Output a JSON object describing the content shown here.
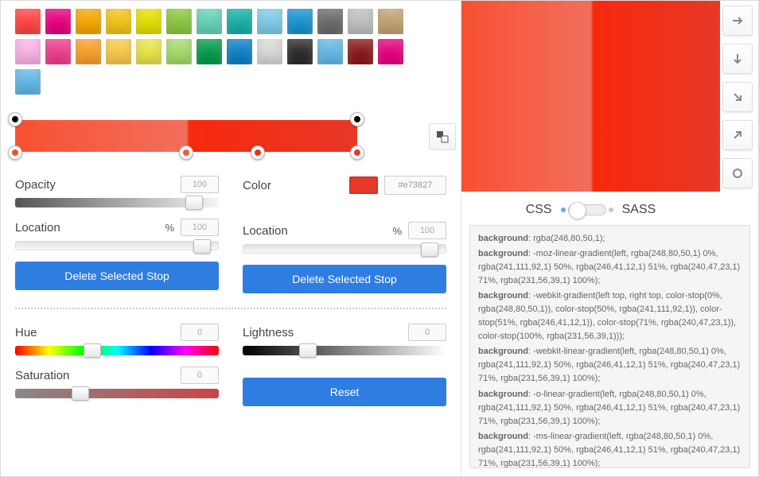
{
  "swatches": [
    [
      "#f44",
      "#e6007e",
      "#f7a600",
      "#f0c419",
      "#e3df00",
      "#8cc63f",
      "#66d1b5",
      "#16b1a5",
      "#7ecbe8",
      "#1893d1",
      "#6a6a6a",
      "#bfbfbf",
      "#c0a373"
    ],
    [
      "#fbb1e6",
      "#ef3d8e",
      "#f9a02a",
      "#f8c94a",
      "#e8e348",
      "#a6d96a",
      "#079b4a",
      "#0e80c7",
      "#d8d8d8",
      "#2b2b2b",
      "#63b8e5",
      "#8b1a1a",
      "#e6007e"
    ],
    [
      "#63b8e5"
    ]
  ],
  "grad_stops_top": [
    {
      "pos": 0,
      "dot": "#000"
    },
    {
      "pos": 100,
      "dot": "#000"
    }
  ],
  "grad_stops_bottom": [
    {
      "pos": 0,
      "dot": "#f84f32"
    },
    {
      "pos": 50,
      "dot": "#f05a3f"
    },
    {
      "pos": 71,
      "dot": "#f02f17"
    },
    {
      "pos": 100,
      "dot": "#e73827"
    }
  ],
  "opacity": {
    "label": "Opacity",
    "value": "100",
    "thumb_pct": 88
  },
  "locationL": {
    "label": "Location",
    "unit": "%",
    "value": "100",
    "thumb_pct": 92
  },
  "color": {
    "label": "Color",
    "hex": "#e73827"
  },
  "locationR": {
    "label": "Location",
    "unit": "%",
    "value": "100",
    "thumb_pct": 92
  },
  "deleteL": "Delete Selected Stop",
  "deleteR": "Delete Selected Stop",
  "hue": {
    "label": "Hue",
    "value": "0",
    "thumb_pct": 38
  },
  "sat": {
    "label": "Saturation",
    "value": "0",
    "thumb_pct": 32
  },
  "lightness": {
    "label": "Lightness",
    "value": "0",
    "thumb_pct": 32
  },
  "reset": "Reset",
  "tabs": {
    "css": "CSS",
    "sass": "SASS"
  },
  "css_lines": [
    {
      "prop": "background",
      "val": ": rgba(248,80,50,1);"
    },
    {
      "prop": "background",
      "val": ": -moz-linear-gradient(left, rgba(248,80,50,1) 0%, rgba(241,111,92,1) 50%, rgba(246,41,12,1) 51%, rgba(240,47,23,1) 71%, rgba(231,56,39,1) 100%);"
    },
    {
      "prop": "background",
      "val": ": -webkit-gradient(left top, right top, color-stop(0%, rgba(248,80,50,1)), color-stop(50%, rgba(241,111,92,1)), color-stop(51%, rgba(246,41,12,1)), color-stop(71%, rgba(240,47,23,1)), color-stop(100%, rgba(231,56,39,1)));"
    },
    {
      "prop": "background",
      "val": ": -webkit-linear-gradient(left, rgba(248,80,50,1) 0%, rgba(241,111,92,1) 50%, rgba(246,41,12,1) 51%, rgba(240,47,23,1) 71%, rgba(231,56,39,1) 100%);"
    },
    {
      "prop": "background",
      "val": ": -o-linear-gradient(left, rgba(248,80,50,1) 0%, rgba(241,111,92,1) 50%, rgba(246,41,12,1) 51%, rgba(240,47,23,1) 71%, rgba(231,56,39,1) 100%);"
    },
    {
      "prop": "background",
      "val": ": -ms-linear-gradient(left, rgba(248,80,50,1) 0%, rgba(241,111,92,1) 50%, rgba(246,41,12,1) 51%, rgba(240,47,23,1) 71%, rgba(231,56,39,1) 100%);"
    }
  ]
}
